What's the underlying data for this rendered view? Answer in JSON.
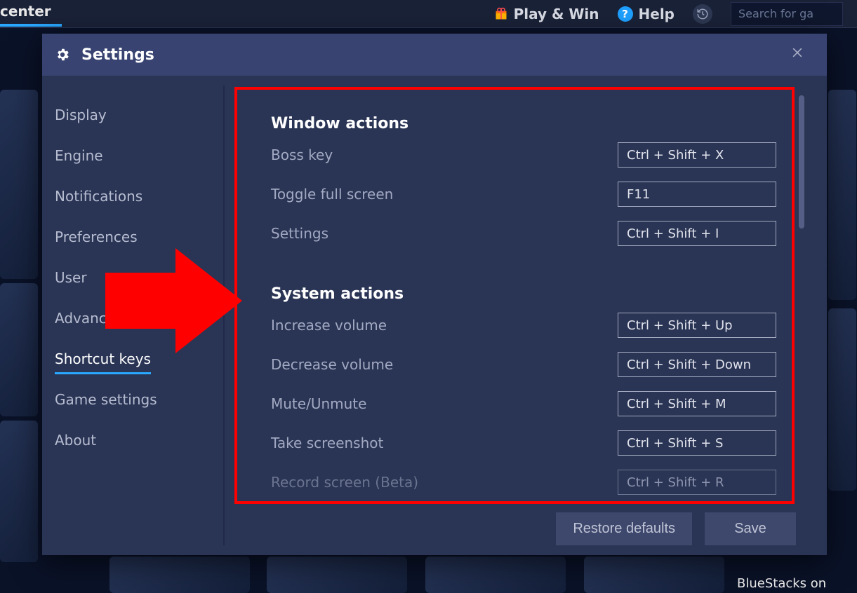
{
  "topbar": {
    "center_label": "center",
    "play_win": "Play & Win",
    "help": "Help",
    "search_placeholder": "Search for ga"
  },
  "modal": {
    "title": "Settings"
  },
  "sidebar": {
    "items": [
      {
        "label": "Display"
      },
      {
        "label": "Engine"
      },
      {
        "label": "Notifications"
      },
      {
        "label": "Preferences"
      },
      {
        "label": "User"
      },
      {
        "label": "Advanced"
      },
      {
        "label": "Shortcut keys"
      },
      {
        "label": "Game settings"
      },
      {
        "label": "About"
      }
    ],
    "active_index": 6
  },
  "sections": {
    "window_actions": {
      "title": "Window actions",
      "rows": [
        {
          "label": "Boss key",
          "key": "Ctrl + Shift + X"
        },
        {
          "label": "Toggle full screen",
          "key": "F11"
        },
        {
          "label": "Settings",
          "key": "Ctrl + Shift + I"
        }
      ]
    },
    "system_actions": {
      "title": "System actions",
      "rows": [
        {
          "label": "Increase volume",
          "key": "Ctrl + Shift + Up"
        },
        {
          "label": "Decrease volume",
          "key": "Ctrl + Shift + Down"
        },
        {
          "label": "Mute/Unmute",
          "key": "Ctrl + Shift + M"
        },
        {
          "label": "Take screenshot",
          "key": "Ctrl + Shift + S"
        },
        {
          "label": "Record screen (Beta)",
          "key": "Ctrl + Shift + R"
        }
      ]
    }
  },
  "footer": {
    "restore": "Restore defaults",
    "save": "Save"
  },
  "bg": {
    "bluestacks_label": "BlueStacks on"
  }
}
